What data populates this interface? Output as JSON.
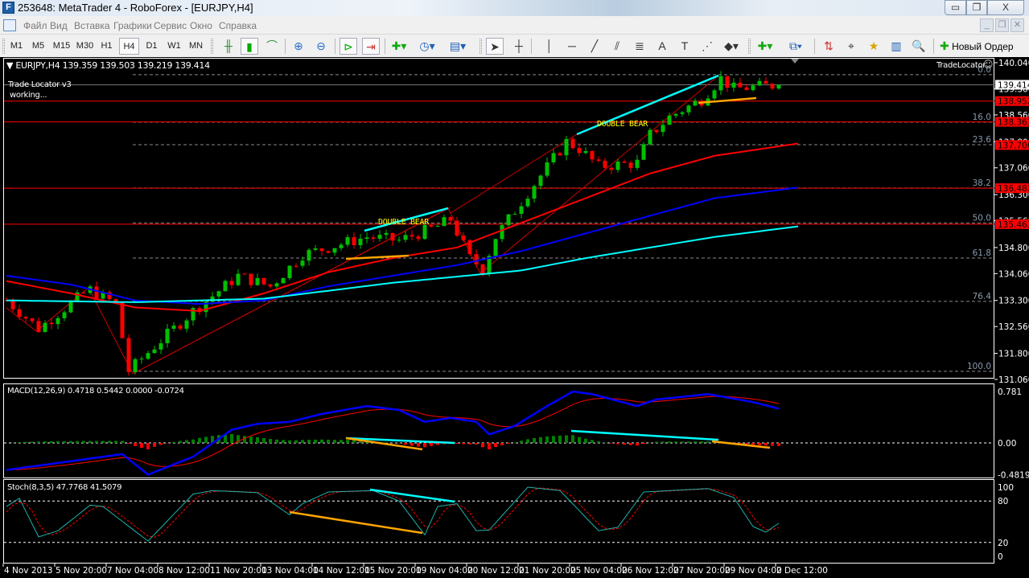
{
  "window": {
    "title": "253648: MetaTrader 4 - RoboForex - [EURJPY,H4]",
    "logo": "F",
    "minimize": "▭",
    "restore": "❐",
    "close": "X"
  },
  "menu": [
    "Файл",
    "Вид",
    "Вставка",
    "Графики",
    "Сервис",
    "Окно",
    "Справка"
  ],
  "timeframes": [
    "M1",
    "M5",
    "M15",
    "M30",
    "H1",
    "H4",
    "D1",
    "W1",
    "MN"
  ],
  "active_timeframe": "H4",
  "toolbar": {
    "new_order": "Новый Ордер"
  },
  "chart": {
    "header": "EURJPY,H4  139.359 139.503 139.219 139.414",
    "indicator_name": "Trade Locator v3",
    "indicator_status": "working...",
    "trade_locator_label": "TradeLocator",
    "pattern_labels": [
      "DOUBLE BEAR",
      "DOUBLE BEAR"
    ],
    "colors": {
      "bull": "#00c000",
      "bear": "#ff0000",
      "ma_fast": "#ff0000",
      "ma_mid": "#0000ff",
      "ma_slow": "#00ffff",
      "divergence_up": "#00ffff",
      "divergence_down": "#ffa500"
    },
    "price_ticks": [
      "140.040",
      "139.300",
      "138.560",
      "137.800",
      "137.060",
      "136.300",
      "135.560",
      "134.800",
      "134.060",
      "133.300",
      "132.560",
      "131.800",
      "131.060"
    ],
    "current_price": "139.414",
    "level_tags": [
      "138.952",
      "138.363",
      "137.706",
      "136.483",
      "135.463"
    ],
    "fib_levels": [
      "0.0",
      "16.0",
      "23.6",
      "38.2",
      "50.0",
      "61.8",
      "76.4",
      "100.0"
    ],
    "fib_range": [
      139.7,
      131.29
    ],
    "close_anchors": [
      [
        0,
        133.3
      ],
      [
        5,
        132.5
      ],
      [
        12,
        133.5
      ],
      [
        13,
        133.6
      ],
      [
        17,
        133.2
      ],
      [
        19,
        131.3
      ],
      [
        23,
        132.0
      ],
      [
        29,
        133.0
      ],
      [
        36,
        134.0
      ],
      [
        41,
        133.7
      ],
      [
        46,
        134.6
      ],
      [
        56,
        135.1
      ],
      [
        61,
        135.0
      ],
      [
        67,
        135.4
      ],
      [
        69,
        135.6
      ],
      [
        72,
        134.5
      ],
      [
        74,
        134.2
      ],
      [
        76,
        135.1
      ],
      [
        82,
        136.6
      ],
      [
        87,
        137.8
      ],
      [
        89,
        137.6
      ],
      [
        92,
        137.1
      ],
      [
        98,
        137.2
      ],
      [
        100,
        138.0
      ],
      [
        103,
        138.5
      ],
      [
        108,
        139.0
      ],
      [
        111,
        139.6
      ],
      [
        113,
        139.3
      ],
      [
        120,
        139.414
      ]
    ],
    "ma_fast": [
      [
        0,
        133.85
      ],
      [
        10,
        133.5
      ],
      [
        20,
        133.1
      ],
      [
        30,
        133.0
      ],
      [
        40,
        133.5
      ],
      [
        50,
        134.1
      ],
      [
        60,
        134.5
      ],
      [
        70,
        134.8
      ],
      [
        80,
        135.5
      ],
      [
        90,
        136.2
      ],
      [
        100,
        136.9
      ],
      [
        110,
        137.4
      ],
      [
        123,
        137.75
      ]
    ],
    "ma_mid": [
      [
        0,
        134.0
      ],
      [
        10,
        133.75
      ],
      [
        20,
        133.3
      ],
      [
        30,
        133.2
      ],
      [
        40,
        133.3
      ],
      [
        50,
        133.7
      ],
      [
        60,
        134.0
      ],
      [
        70,
        134.3
      ],
      [
        80,
        134.7
      ],
      [
        90,
        135.2
      ],
      [
        100,
        135.7
      ],
      [
        110,
        136.2
      ],
      [
        123,
        136.5
      ]
    ],
    "ma_slow": [
      [
        0,
        133.3
      ],
      [
        20,
        133.25
      ],
      [
        40,
        133.35
      ],
      [
        60,
        133.8
      ],
      [
        80,
        134.15
      ],
      [
        90,
        134.5
      ],
      [
        100,
        134.8
      ],
      [
        110,
        135.1
      ],
      [
        123,
        135.4
      ]
    ]
  },
  "macd": {
    "label": "MACD(12,26,9) 0.4718 0.5442 0.0000 -0.0724",
    "ticks": [
      "0.781",
      "0.00",
      "-0.4819"
    ],
    "main": [
      [
        0,
        -0.41
      ],
      [
        18,
        -0.17
      ],
      [
        22,
        -0.48
      ],
      [
        29,
        -0.21
      ],
      [
        35,
        0.2
      ],
      [
        39,
        0.29
      ],
      [
        44,
        0.32
      ],
      [
        49,
        0.44
      ],
      [
        56,
        0.56
      ],
      [
        61,
        0.5
      ],
      [
        65,
        0.32
      ],
      [
        69,
        0.38
      ],
      [
        73,
        0.32
      ],
      [
        75,
        0.13
      ],
      [
        79,
        0.26
      ],
      [
        84,
        0.56
      ],
      [
        88,
        0.78
      ],
      [
        91,
        0.74
      ],
      [
        98,
        0.56
      ],
      [
        101,
        0.66
      ],
      [
        109,
        0.74
      ],
      [
        116,
        0.62
      ],
      [
        120,
        0.52
      ]
    ]
  },
  "stoch": {
    "label": "Stoch(8,3,5) 47.7768 41.5079",
    "ticks": [
      "100",
      "80",
      "20",
      "0"
    ],
    "main": [
      [
        0,
        72
      ],
      [
        2,
        84
      ],
      [
        5,
        28
      ],
      [
        8,
        37
      ],
      [
        13,
        74
      ],
      [
        15,
        72
      ],
      [
        22,
        22
      ],
      [
        29,
        90
      ],
      [
        32,
        95
      ],
      [
        39,
        92
      ],
      [
        44,
        60
      ],
      [
        46,
        76
      ],
      [
        50,
        93
      ],
      [
        57,
        95
      ],
      [
        61,
        80
      ],
      [
        65,
        31
      ],
      [
        67,
        72
      ],
      [
        70,
        76
      ],
      [
        73,
        37
      ],
      [
        75,
        38
      ],
      [
        81,
        100
      ],
      [
        86,
        95
      ],
      [
        92,
        37
      ],
      [
        95,
        42
      ],
      [
        99,
        93
      ],
      [
        109,
        98
      ],
      [
        113,
        85
      ],
      [
        116,
        43
      ],
      [
        118,
        35
      ],
      [
        120,
        47.8
      ]
    ]
  },
  "time_labels": [
    "4 Nov 2013",
    "5 Nov 20:00",
    "7 Nov 04:00",
    "8 Nov 12:00",
    "11 Nov 20:00",
    "13 Nov 04:00",
    "14 Nov 12:00",
    "15 Nov 20:00",
    "19 Nov 04:00",
    "20 Nov 12:00",
    "21 Nov 20:00",
    "25 Nov 04:00",
    "26 Nov 12:00",
    "27 Nov 20:00",
    "29 Nov 04:00",
    "2 Dec 12:00"
  ]
}
